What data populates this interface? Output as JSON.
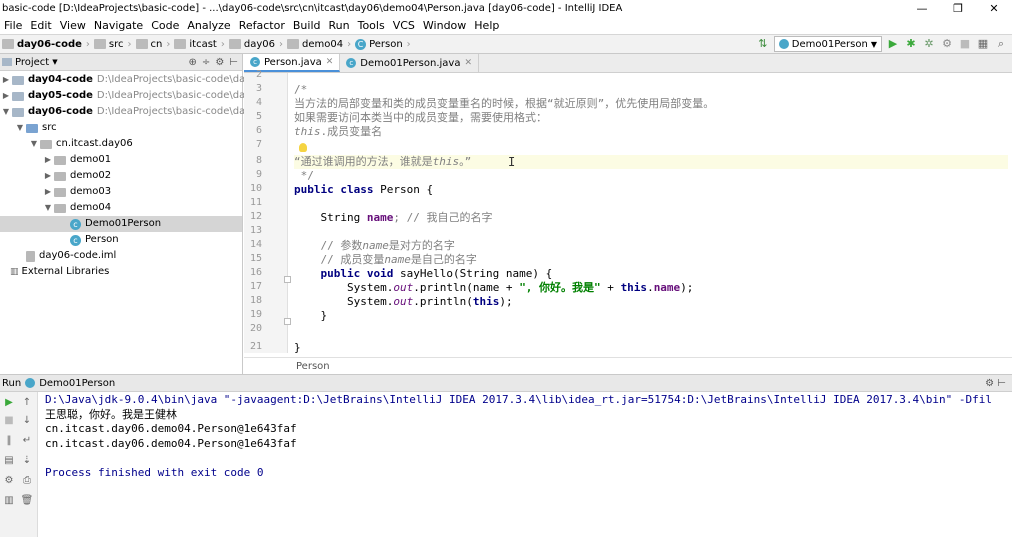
{
  "window": {
    "title": "basic-code [D:\\IdeaProjects\\basic-code] - ...\\day06-code\\src\\cn\\itcast\\day06\\demo04\\Person.java [day06-code] - IntelliJ IDEA",
    "minimize": "—",
    "maximize": "❐",
    "close": "✕"
  },
  "menu": [
    "File",
    "Edit",
    "View",
    "Navigate",
    "Code",
    "Analyze",
    "Refactor",
    "Build",
    "Run",
    "Tools",
    "VCS",
    "Window",
    "Help"
  ],
  "breadcrumbs": [
    "day06-code",
    "src",
    "cn",
    "itcast",
    "day06",
    "demo04",
    "Person"
  ],
  "toolbar": {
    "run_config": "Demo01Person"
  },
  "project_panel": {
    "title": "Project",
    "items": [
      {
        "label": "day04-code",
        "path": "D:\\IdeaProjects\\basic-code\\day04-co"
      },
      {
        "label": "day05-code",
        "path": "D:\\IdeaProjects\\basic-code\\day05-co"
      },
      {
        "label": "day06-code",
        "path": "D:\\IdeaProjects\\basic-code\\day06-co"
      },
      {
        "label": "src"
      },
      {
        "label": "cn.itcast.day06"
      },
      {
        "label": "demo01"
      },
      {
        "label": "demo02"
      },
      {
        "label": "demo03"
      },
      {
        "label": "demo04"
      },
      {
        "label": "Demo01Person"
      },
      {
        "label": "Person"
      },
      {
        "label": "day06-code.iml"
      },
      {
        "label": "External Libraries"
      }
    ]
  },
  "editor": {
    "tabs": [
      "Person.java",
      "Demo01Person.java"
    ],
    "line_numbers": [
      "2",
      "3",
      "4",
      "5",
      "6",
      "7",
      "8",
      "9",
      "10",
      "11",
      "12",
      "13",
      "14",
      "15",
      "16",
      "17",
      "18",
      "19",
      "20",
      "21"
    ],
    "code": {
      "l3": "/*",
      "l4": "当方法的局部变量和类的成员变量重名的时候，根据“就近原则”，优先使用局部变量。",
      "l5": "如果需要访问本类当中的成员变量，需要使用格式：",
      "l6a": "this",
      "l6b": ".成员变量名",
      "l8a": "“通过谁调用的方法，谁就是",
      "l8b": "this",
      "l8c": "。”",
      "l9": " */",
      "l10a": "public class",
      "l10b": " Person {",
      "l12a": "    String ",
      "l12b": "name",
      "l12c": "; // 我自己的名字",
      "l14a": "    // 参数",
      "l14b": "name",
      "l14c": "是对方的名字",
      "l15a": "    // 成员变量",
      "l15b": "name",
      "l15c": "是自己的名字",
      "l16a": "    public void",
      "l16b": " sayHello(String name) {",
      "l17a": "        System.",
      "l17b": "out",
      "l17c": ".println(name + ",
      "l17d": "\", 你好。我是\"",
      "l17e": " + ",
      "l17f": "this",
      "l17g": ".",
      "l17h": "name",
      "l17i": ");",
      "l18a": "        System.",
      "l18b": "out",
      "l18c": ".println(",
      "l18d": "this",
      "l18e": ");",
      "l19": "    }",
      "l21": "}"
    },
    "footer_breadcrumb": "Person"
  },
  "run_panel": {
    "label": "Run",
    "config": "Demo01Person",
    "output": [
      "D:\\Java\\jdk-9.0.4\\bin\\java \"-javaagent:D:\\JetBrains\\IntelliJ IDEA 2017.3.4\\lib\\idea_rt.jar=51754:D:\\JetBrains\\IntelliJ IDEA 2017.3.4\\bin\" -Dfil",
      "王思聪，你好。我是王健林",
      "cn.itcast.day06.demo04.Person@1e643faf",
      "cn.itcast.day06.demo04.Person@1e643faf",
      "",
      "Process finished with exit code 0"
    ]
  }
}
